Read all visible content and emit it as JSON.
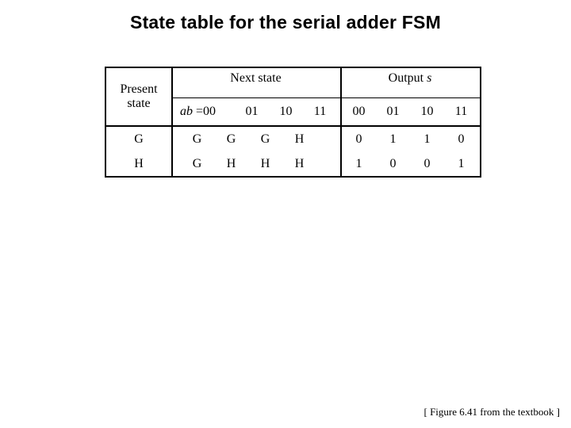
{
  "title": "State table for the serial adder FSM",
  "table": {
    "present_state_header": {
      "line1": "Present",
      "line2": "state"
    },
    "next_state_header": "Next state",
    "output_header_text": "Output",
    "output_header_symbol": "s",
    "input_label_italic": "ab",
    "input_label_equals": "=00",
    "next_state_columns": [
      "01",
      "10",
      "11"
    ],
    "output_columns": [
      "00",
      "01",
      "10",
      "11"
    ],
    "rows": [
      {
        "present_state": "G",
        "next_state": [
          "G",
          "G",
          "G",
          "H"
        ],
        "output": [
          "0",
          "1",
          "1",
          "0"
        ]
      },
      {
        "present_state": "H",
        "next_state": [
          "G",
          "H",
          "H",
          "H"
        ],
        "output": [
          "1",
          "0",
          "0",
          "1"
        ]
      }
    ]
  },
  "footer": {
    "credit": "[ Figure 6.41 from the textbook ]"
  },
  "colors": {
    "background": "#ffffff",
    "text": "#000000",
    "rule": "#000000"
  }
}
